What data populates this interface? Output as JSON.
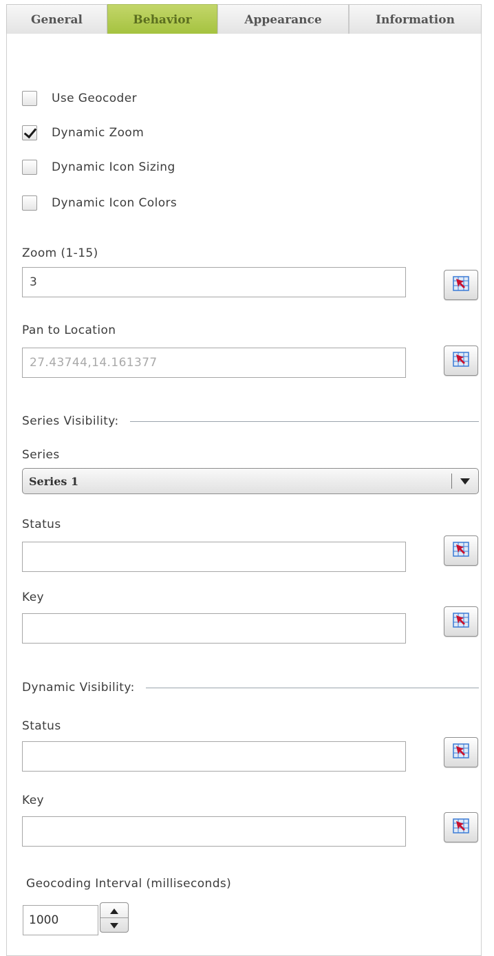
{
  "tabs": [
    {
      "label": "General",
      "active": false
    },
    {
      "label": "Behavior",
      "active": true
    },
    {
      "label": "Appearance",
      "active": false
    },
    {
      "label": "Information",
      "active": false
    }
  ],
  "options": [
    {
      "label": "Use Geocoder",
      "checked": false
    },
    {
      "label": "Dynamic Zoom",
      "checked": true
    },
    {
      "label": "Dynamic Icon Sizing",
      "checked": false
    },
    {
      "label": "Dynamic Icon Colors",
      "checked": false
    }
  ],
  "zoom": {
    "label": "Zoom (1-15)",
    "value": "3"
  },
  "pan": {
    "label": "Pan to Location",
    "value": "27.43744,14.161377"
  },
  "series_visibility": {
    "heading": "Series Visibility:",
    "series_label": "Series",
    "series_value": "Series 1",
    "status_label": "Status",
    "status_value": "",
    "key_label": "Key",
    "key_value": ""
  },
  "dynamic_visibility": {
    "heading": "Dynamic Visibility:",
    "status_label": "Status",
    "status_value": "",
    "key_label": "Key",
    "key_value": ""
  },
  "geocoding_interval": {
    "label": "Geocoding Interval (milliseconds)",
    "value": "1000"
  },
  "icons": {
    "picker": "field-picker-icon",
    "dropdown": "chevron-down-icon",
    "up": "arrow-up-icon",
    "down": "arrow-down-icon"
  },
  "colors": {
    "active_tab": "#a4c23f",
    "picker_arrow": "#c8102e",
    "picker_grid": "#3a7bd5"
  }
}
